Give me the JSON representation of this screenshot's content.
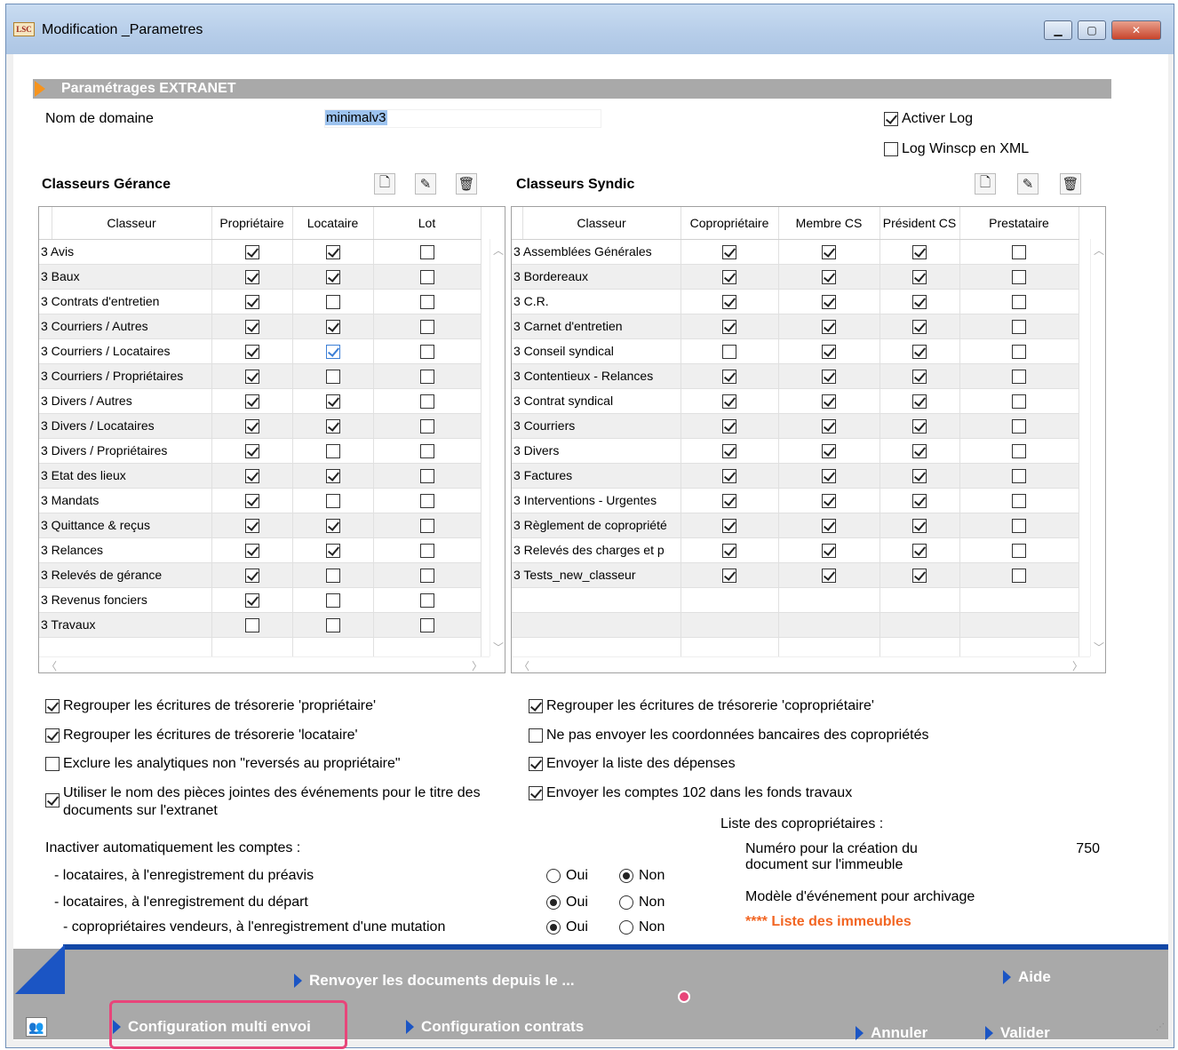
{
  "window": {
    "title": "Modification _Parametres",
    "logo": "LSC"
  },
  "section": {
    "title": "Paramétrages EXTRANET"
  },
  "domain": {
    "label": "Nom de domaine",
    "value": "minimalv3"
  },
  "log": {
    "activer_label": "Activer Log",
    "activer_checked": true,
    "winscp_label": "Log Winscp en XML",
    "winscp_checked": false
  },
  "gerance": {
    "title": "Classeurs Gérance",
    "columns": [
      "Classeur",
      "Propriétaire",
      "Locataire",
      "Lot"
    ],
    "rows": [
      {
        "name": "3 Avis",
        "checks": [
          true,
          true,
          false
        ]
      },
      {
        "name": "3 Baux",
        "checks": [
          true,
          true,
          false
        ]
      },
      {
        "name": "3 Contrats d'entretien",
        "checks": [
          true,
          false,
          false
        ]
      },
      {
        "name": "3 Courriers / Autres",
        "checks": [
          true,
          true,
          false
        ]
      },
      {
        "name": "3 Courriers / Locataires",
        "checks": [
          true,
          true,
          false
        ],
        "blue": 1
      },
      {
        "name": "3 Courriers / Propriétaires",
        "checks": [
          true,
          false,
          false
        ]
      },
      {
        "name": "3 Divers / Autres",
        "checks": [
          true,
          true,
          false
        ]
      },
      {
        "name": "3 Divers / Locataires",
        "checks": [
          true,
          true,
          false
        ]
      },
      {
        "name": "3 Divers / Propriétaires",
        "checks": [
          true,
          false,
          false
        ]
      },
      {
        "name": "3 Etat des lieux",
        "checks": [
          true,
          true,
          false
        ]
      },
      {
        "name": "3 Mandats",
        "checks": [
          true,
          false,
          false
        ]
      },
      {
        "name": "3 Quittance & reçus",
        "checks": [
          true,
          true,
          false
        ]
      },
      {
        "name": "3 Relances",
        "checks": [
          true,
          true,
          false
        ]
      },
      {
        "name": "3 Relevés de gérance",
        "checks": [
          true,
          false,
          false
        ]
      },
      {
        "name": "3 Revenus fonciers",
        "checks": [
          true,
          false,
          false
        ]
      },
      {
        "name": "3 Travaux",
        "checks": [
          false,
          false,
          false
        ]
      }
    ]
  },
  "syndic": {
    "title": "Classeurs Syndic",
    "columns": [
      "Classeur",
      "Copropriétaire",
      "Membre CS",
      "Président CS",
      "Prestataire"
    ],
    "rows": [
      {
        "name": "3 Assemblées Générales",
        "checks": [
          true,
          true,
          true,
          false
        ]
      },
      {
        "name": "3 Bordereaux",
        "checks": [
          true,
          true,
          true,
          false
        ]
      },
      {
        "name": "3 C.R.",
        "checks": [
          true,
          true,
          true,
          false
        ]
      },
      {
        "name": "3 Carnet d'entretien",
        "checks": [
          true,
          true,
          true,
          false
        ]
      },
      {
        "name": "3 Conseil syndical",
        "checks": [
          false,
          true,
          true,
          false
        ]
      },
      {
        "name": "3 Contentieux - Relances",
        "checks": [
          true,
          true,
          true,
          false
        ]
      },
      {
        "name": "3 Contrat syndical",
        "checks": [
          true,
          true,
          true,
          false
        ]
      },
      {
        "name": "3 Courriers",
        "checks": [
          true,
          true,
          true,
          false
        ]
      },
      {
        "name": "3 Divers",
        "checks": [
          true,
          true,
          true,
          false
        ]
      },
      {
        "name": "3 Factures",
        "checks": [
          true,
          true,
          true,
          false
        ]
      },
      {
        "name": "3 Interventions - Urgentes",
        "checks": [
          true,
          true,
          true,
          false
        ]
      },
      {
        "name": "3 Règlement de copropriété",
        "checks": [
          true,
          true,
          true,
          false
        ]
      },
      {
        "name": "3 Relevés des charges et p",
        "checks": [
          true,
          true,
          true,
          false
        ]
      },
      {
        "name": "3 Tests_new_classeur",
        "checks": [
          true,
          true,
          true,
          false
        ]
      }
    ]
  },
  "options_left": [
    {
      "label": "Regrouper les écritures de trésorerie 'propriétaire'",
      "checked": true
    },
    {
      "label": "Regrouper les écritures de trésorerie 'locataire'",
      "checked": true
    },
    {
      "label": "Exclure les analytiques non \"reversés au propriétaire\"",
      "checked": false
    },
    {
      "label": "Utiliser le nom des pièces jointes des événements pour le titre des",
      "label2": "documents sur l'extranet",
      "checked": true
    }
  ],
  "options_right": [
    {
      "label": "Regrouper les écritures de trésorerie 'copropriétaire'",
      "checked": true
    },
    {
      "label": "Ne pas envoyer les coordonnées bancaires des copropriétés",
      "checked": false
    },
    {
      "label": "Envoyer la liste des dépenses",
      "checked": true
    },
    {
      "label": "Envoyer les comptes 102 dans les fonds travaux",
      "checked": true
    }
  ],
  "inactiver": {
    "title": "Inactiver automatiquement les comptes :",
    "oui": "Oui",
    "non": "Non",
    "rows": [
      {
        "label": "- locataires, à l'enregistrement du préavis",
        "value": "Non"
      },
      {
        "label": "- locataires, à l'enregistrement du départ",
        "value": "Oui"
      },
      {
        "label": "- copropriétaires vendeurs, à l'enregistrement d'une mutation",
        "value": "Oui"
      }
    ]
  },
  "coproprietaires": {
    "title": "Liste des copropriétaires :",
    "numero_label1": "Numéro pour la création du",
    "numero_label2": "document sur l'immeuble",
    "numero_value": "750",
    "modele_label": "Modèle d'événement pour archivage",
    "modele_stars": "****",
    "modele_value": "Liste des immeubles"
  },
  "actions": {
    "renvoyer": "Renvoyer les documents depuis le ...",
    "aide": "Aide",
    "multi_envoi": "Configuration multi envoi",
    "contrats": "Configuration contrats",
    "annuler": "Annuler",
    "valider": "Valider"
  },
  "colors": {
    "accent": "#1b55c4",
    "highlight": "#e8457a",
    "orange": "#f7941d",
    "header_gray": "#a9a9a9"
  }
}
